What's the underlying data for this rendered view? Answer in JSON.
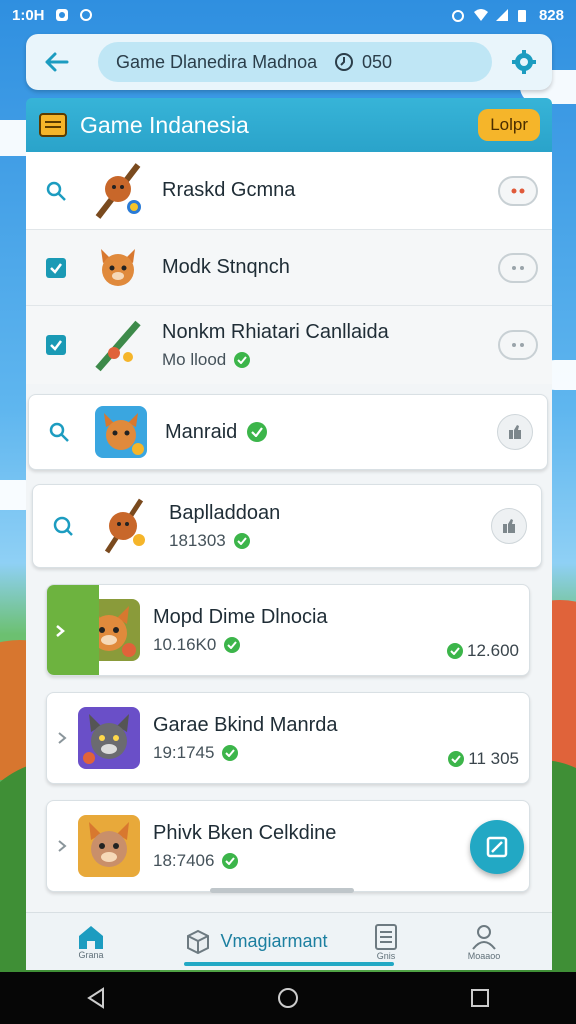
{
  "status_bar": {
    "time": "1:0H",
    "right_text": "828"
  },
  "top_bar": {
    "search_value": "Game Dlanedira Madnoa",
    "search_suffix": "050"
  },
  "header": {
    "title": "Game Indanesia",
    "help_label": "Lolpr"
  },
  "list": {
    "items": [
      {
        "title": "Rraskd Gcmna",
        "subtitle": "",
        "price": ""
      },
      {
        "title": "Modk Stnqnch",
        "subtitle": "",
        "price": ""
      },
      {
        "title": "Nonkm Rhiatari Canllaida",
        "subtitle": "Mo llood",
        "price": ""
      },
      {
        "title": "Manraid",
        "subtitle": "",
        "price": ""
      },
      {
        "title": "Baplladdoan",
        "subtitle": "181303",
        "price": ""
      },
      {
        "title": "Mopd Dime Dlnocia",
        "subtitle": "10.16K0",
        "price": "12.600"
      },
      {
        "title": "Garae Bkind Manrda",
        "subtitle": "19:1745",
        "price": "11 305"
      },
      {
        "title": "Phivk Bken Celkdine",
        "subtitle": "18:7406",
        "price": ""
      }
    ]
  },
  "bottom_nav": {
    "home_label": "Grana",
    "center_label": "Vmagiarmant",
    "docs_label": "Gnis",
    "profile_label": "Moaaoo"
  },
  "colors": {
    "accent": "#2aa3ca",
    "brand_teal": "#22a8c4",
    "help_yellow": "#f5b52a",
    "verified_green": "#3cb54a",
    "featured_green": "#6db33f"
  }
}
